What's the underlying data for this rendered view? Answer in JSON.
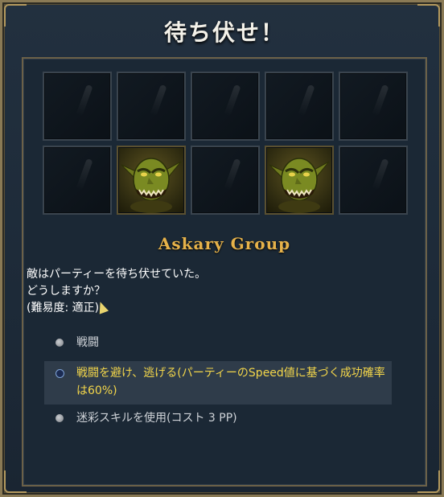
{
  "dialog": {
    "title": "待ち伏せ！"
  },
  "encounter": {
    "group_name": "Askary Group",
    "description_lines": [
      "敵はパーティーを待ち伏せていた。",
      "どうしますか？",
      "(難易度: 適正)"
    ],
    "slots": [
      {
        "row": 1,
        "col": 1,
        "content": "empty"
      },
      {
        "row": 1,
        "col": 2,
        "content": "empty"
      },
      {
        "row": 1,
        "col": 3,
        "content": "empty"
      },
      {
        "row": 1,
        "col": 4,
        "content": "empty"
      },
      {
        "row": 1,
        "col": 5,
        "content": "empty"
      },
      {
        "row": 2,
        "col": 1,
        "content": "empty"
      },
      {
        "row": 2,
        "col": 2,
        "content": "goblin-portrait"
      },
      {
        "row": 2,
        "col": 3,
        "content": "empty"
      },
      {
        "row": 2,
        "col": 4,
        "content": "goblin-portrait"
      },
      {
        "row": 2,
        "col": 5,
        "content": "empty"
      }
    ]
  },
  "options": [
    {
      "label": "戦闘",
      "selected": false
    },
    {
      "label": "戦闘を避け、逃げる(パーティーのSpeed値に基づく成功確率は60%)",
      "selected": true
    },
    {
      "label": "迷彩スキルを使用(コスト 3 PP)",
      "selected": false
    }
  ],
  "colors": {
    "title": "#f4f2ea",
    "group_name": "#e6b24a",
    "selected_option_text": "#f3d64a",
    "option_text": "#cfd3d8",
    "frame_gold": "#b59a5e"
  }
}
